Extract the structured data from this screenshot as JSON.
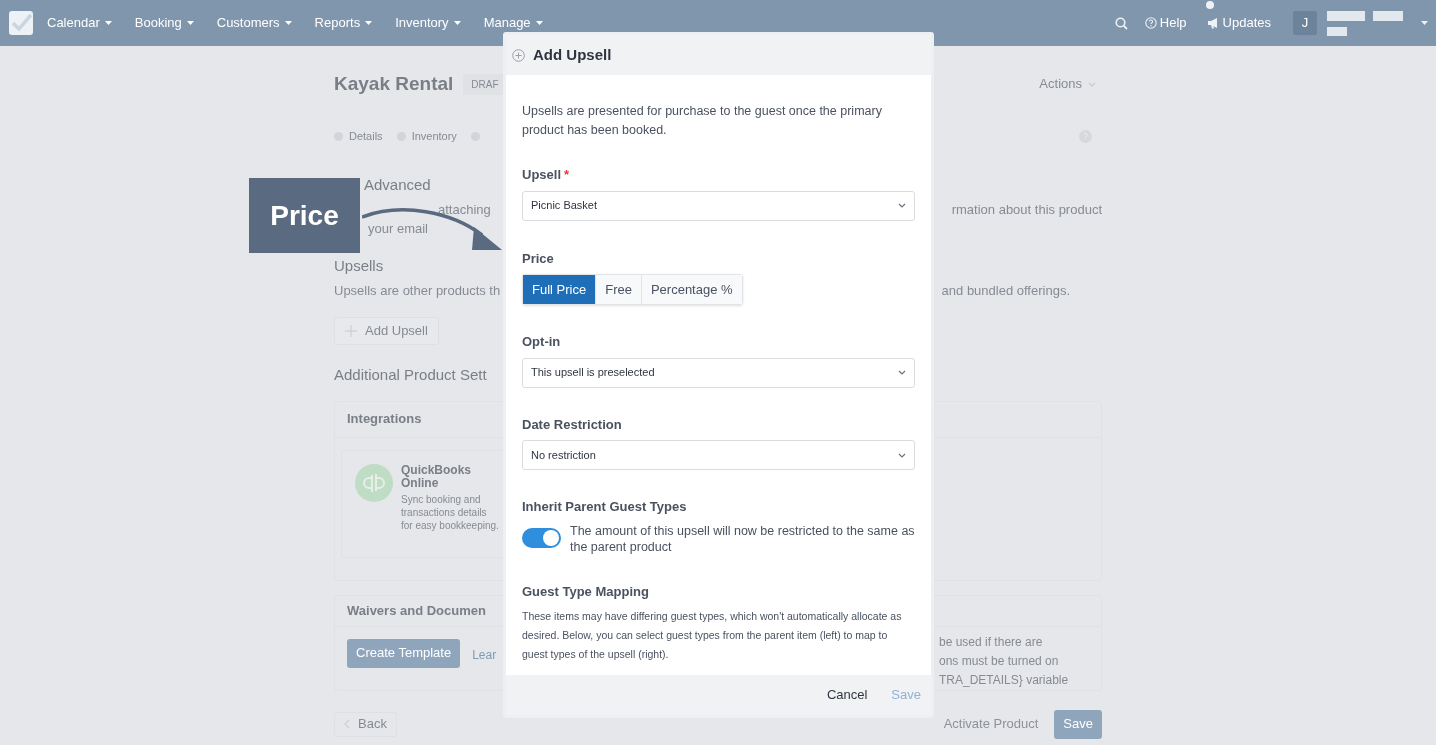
{
  "nav": {
    "items": [
      {
        "label": "Calendar"
      },
      {
        "label": "Booking"
      },
      {
        "label": "Customers"
      },
      {
        "label": "Reports"
      },
      {
        "label": "Inventory"
      },
      {
        "label": "Manage"
      }
    ],
    "help": "Help",
    "updates": "Updates",
    "avatar": "J"
  },
  "page": {
    "title": "Kayak Rental",
    "badge": "DRAF",
    "actions": "Actions",
    "steps": [
      {
        "kind": "labeled",
        "label": "Details"
      },
      {
        "kind": "labeled",
        "label": "Inventory"
      },
      {
        "kind": "dot"
      }
    ],
    "advanced": {
      "heading": "Advanced",
      "line_1": "attaching",
      "line_2": "your email",
      "right": "rmation about this product"
    },
    "upsells": {
      "heading": "Upsells",
      "text": "Upsells are other products th",
      "right": "and bundled offerings.",
      "button": "Add Upsell"
    },
    "additional_heading": "Additional Product Sett",
    "integrations": {
      "heading": "Integrations",
      "name": "QuickBooks Online",
      "description": "Sync booking and transactions details for easy bookkeeping."
    },
    "waivers": {
      "heading": "Waivers and Documen",
      "button": "Create Template",
      "link": "Lear",
      "right_lines": [
        "be used if there are",
        "ons must be turned on",
        "TRA_DETAILS} variable"
      ]
    },
    "footer": {
      "back": "Back",
      "activate": "Activate Product",
      "save": "Save"
    }
  },
  "callout": {
    "label": "Price"
  },
  "modal": {
    "title": "Add Upsell",
    "intro": "Upsells are presented for purchase to the guest once the primary product has been booked.",
    "upsell": {
      "label": "Upsell",
      "required_mark": "*",
      "value": "Picnic Basket"
    },
    "price": {
      "label": "Price",
      "options": [
        {
          "label": "Full Price",
          "selected": true
        },
        {
          "label": "Free",
          "selected": false
        },
        {
          "label": "Percentage %",
          "selected": false
        }
      ]
    },
    "opt_in": {
      "label": "Opt-in",
      "value": "This upsell is preselected"
    },
    "date_restriction": {
      "label": "Date Restriction",
      "value": "No restriction"
    },
    "inherit": {
      "label": "Inherit Parent Guest Types",
      "on": true,
      "text": "The amount of this upsell will now be restricted to the same as the parent product"
    },
    "mapping": {
      "heading": "Guest Type Mapping",
      "text": "These items may have differing guest types, which won't automatically allocate as desired. Below, you can select guest types from the parent item (left) to map to guest types of the upsell (right)."
    },
    "cancel": "Cancel",
    "save": "Save"
  }
}
